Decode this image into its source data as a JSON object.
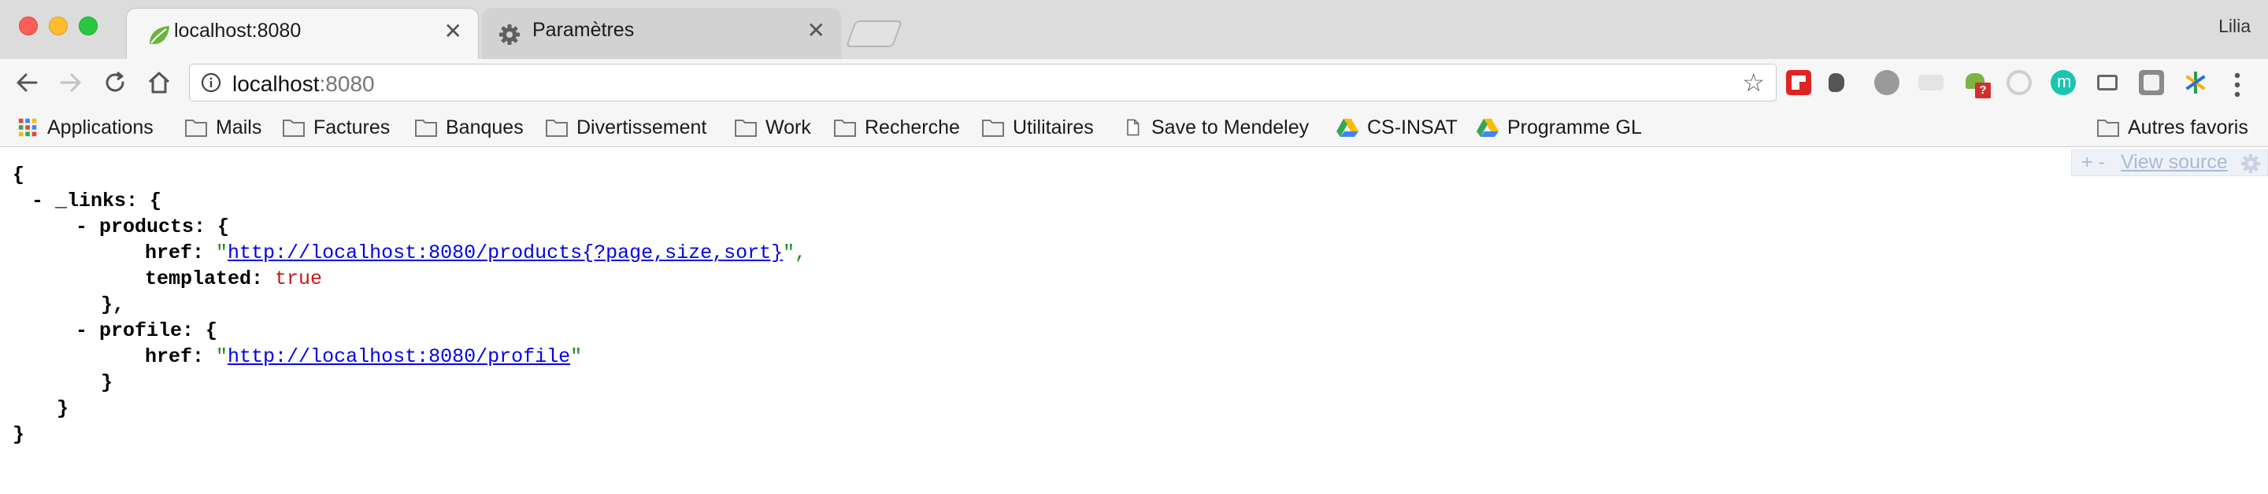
{
  "window": {
    "profile_name": "Lilia"
  },
  "tabs": [
    {
      "title": "localhost:8080",
      "icon": "spring-leaf-icon",
      "active": true
    },
    {
      "title": "Paramètres",
      "icon": "gear-icon",
      "active": false
    }
  ],
  "omnibox": {
    "host": "localhost",
    "port": ":8080"
  },
  "bookmarks": [
    {
      "label": "Applications",
      "icon": "apps-grid-icon"
    },
    {
      "label": "Mails",
      "icon": "folder-icon"
    },
    {
      "label": "Factures",
      "icon": "folder-icon"
    },
    {
      "label": "Banques",
      "icon": "folder-icon"
    },
    {
      "label": "Divertissement",
      "icon": "folder-icon"
    },
    {
      "label": "Work",
      "icon": "folder-icon"
    },
    {
      "label": "Recherche",
      "icon": "folder-icon"
    },
    {
      "label": "Utilitaires",
      "icon": "folder-icon"
    },
    {
      "label": "Save to Mendeley",
      "icon": "page-icon"
    },
    {
      "label": "CS-INSAT",
      "icon": "google-drive-icon"
    },
    {
      "label": "Programme GL",
      "icon": "google-drive-icon"
    }
  ],
  "other_bookmarks": {
    "label": "Autres favoris"
  },
  "json_viewer": {
    "toggle_label": "+ -",
    "view_source": "View source",
    "open_brace": "{",
    "links_key": "- _links:",
    "links_open": " {",
    "products_key": "- products:",
    "products_open": " {",
    "href_key": "href:",
    "quote": "\"",
    "products_href": "http://localhost:8080/products{?page,size,sort}",
    "products_href_tail": "\",",
    "templated_key": "templated:",
    "templated_value": "true",
    "products_close": "},",
    "profile_key": "- profile:",
    "profile_open": " {",
    "profile_href": "http://localhost:8080/profile",
    "profile_close": "}",
    "links_close": "}",
    "close_brace": "}"
  },
  "colors": {
    "link": "#0000ee",
    "string": "#1a8c2c",
    "boolean": "#c41a16"
  }
}
